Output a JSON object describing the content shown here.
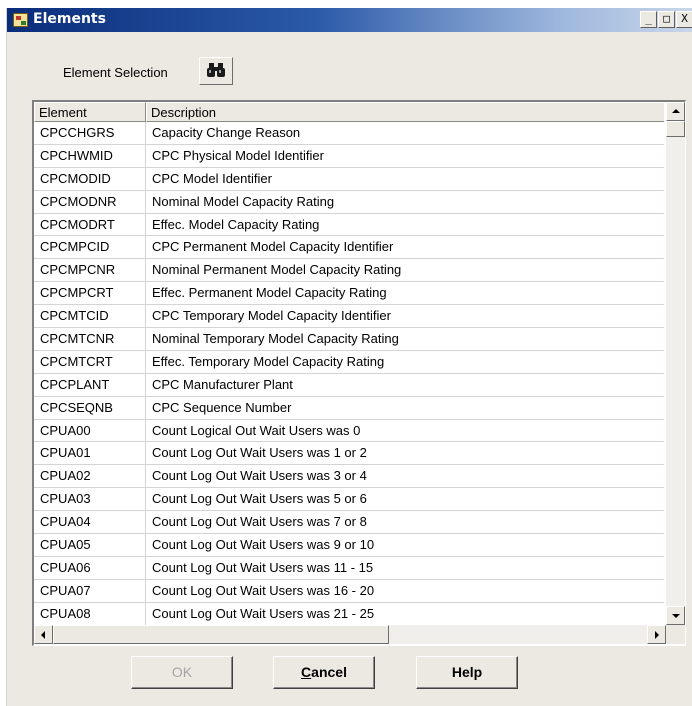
{
  "window": {
    "title": "Elements",
    "minimize_glyph": "_",
    "maximize_glyph": "□",
    "close_glyph": "X"
  },
  "selection": {
    "label": "Element Selection",
    "icon": "binoculars-icon"
  },
  "table": {
    "columns": [
      "Element",
      "Description"
    ],
    "rows": [
      {
        "element": "CPCCHGRS",
        "description": "Capacity Change Reason"
      },
      {
        "element": "CPCHWMID",
        "description": "CPC Physical Model Identifier"
      },
      {
        "element": "CPCMODID",
        "description": "CPC Model Identifier"
      },
      {
        "element": "CPCMODNR",
        "description": "Nominal Model Capacity Rating"
      },
      {
        "element": "CPCMODRT",
        "description": "Effec. Model Capacity Rating"
      },
      {
        "element": "CPCMPCID",
        "description": "CPC Permanent Model Capacity Identifier"
      },
      {
        "element": "CPCMPCNR",
        "description": "Nominal Permanent Model Capacity Rating"
      },
      {
        "element": "CPCMPCRT",
        "description": "Effec. Permanent Model Capacity Rating"
      },
      {
        "element": "CPCMTCID",
        "description": "CPC Temporary Model Capacity Identifier"
      },
      {
        "element": "CPCMTCNR",
        "description": "Nominal Temporary Model Capacity Rating"
      },
      {
        "element": "CPCMTCRT",
        "description": "Effec. Temporary Model Capacity Rating"
      },
      {
        "element": "CPCPLANT",
        "description": "CPC Manufacturer Plant"
      },
      {
        "element": "CPCSEQNB",
        "description": "CPC Sequence Number"
      },
      {
        "element": "CPUA00",
        "description": "Count Logical Out Wait Users was 0"
      },
      {
        "element": "CPUA01",
        "description": "Count Log Out Wait Users was 1 or 2"
      },
      {
        "element": "CPUA02",
        "description": "Count Log Out Wait Users was 3 or 4"
      },
      {
        "element": "CPUA03",
        "description": "Count Log Out Wait Users was 5 or 6"
      },
      {
        "element": "CPUA04",
        "description": "Count Log Out Wait Users was 7 or 8"
      },
      {
        "element": "CPUA05",
        "description": "Count Log Out Wait Users was 9 or 10"
      },
      {
        "element": "CPUA06",
        "description": "Count Log Out Wait Users was 11 - 15"
      },
      {
        "element": "CPUA07",
        "description": "Count Log Out Wait Users was 16 - 20"
      },
      {
        "element": "CPUA08",
        "description": "Count Log Out Wait Users was 21 - 25"
      }
    ]
  },
  "buttons": {
    "ok": "OK",
    "cancel_first": "C",
    "cancel_rest": "ancel",
    "help": "Help"
  },
  "colors": {
    "titlebar_start": "#0a2d7a",
    "titlebar_end": "#c9d6ea",
    "dialog_bg": "#ece9e3",
    "disabled_text": "#a5a5a5"
  }
}
